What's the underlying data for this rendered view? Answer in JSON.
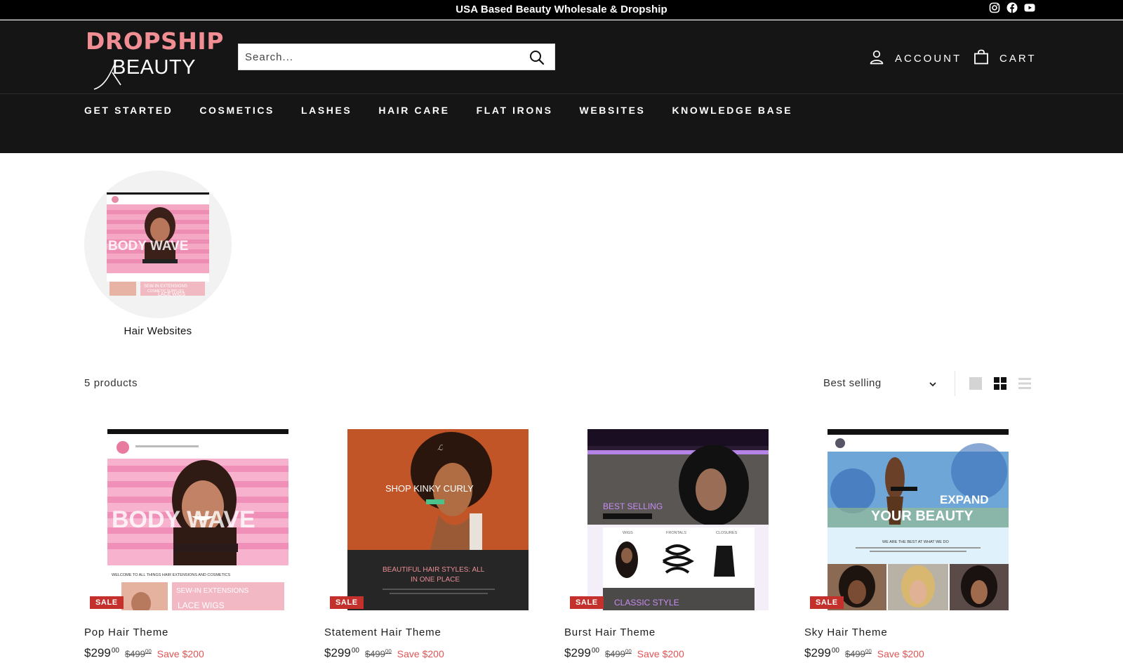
{
  "announcement": {
    "text": "USA Based Beauty Wholesale & Dropship"
  },
  "social_icons": [
    "instagram-icon",
    "facebook-icon",
    "youtube-icon"
  ],
  "logo": {
    "top": "DROPSHIP",
    "bottom": "BEAUTY"
  },
  "search": {
    "placeholder": "Search..."
  },
  "header": {
    "account_label": "ACCOUNT",
    "cart_label": "CART"
  },
  "nav": {
    "items": [
      {
        "label": "GET STARTED"
      },
      {
        "label": "COSMETICS"
      },
      {
        "label": "LASHES"
      },
      {
        "label": "HAIR CARE"
      },
      {
        "label": "FLAT IRONS"
      },
      {
        "label": "WEBSITES"
      },
      {
        "label": "KNOWLEDGE BASE"
      }
    ]
  },
  "collection": {
    "label": "Hair Websites",
    "thumb_text": "BODY WAVE",
    "thumb_sub": [
      "SEW-IN EXTENSIONS",
      "COSMETIC SUPPLIES",
      "LACE WIGS"
    ]
  },
  "toolbar": {
    "count": "5 products",
    "sort_value": "Best selling"
  },
  "products": [
    {
      "title": "Pop Hair Theme",
      "price_main": "$299",
      "price_cents": "00",
      "compare_main": "$499",
      "compare_cents": "00",
      "save": "Save $200",
      "badge": "SALE",
      "thumb_headline": "BODY WAVE",
      "thumb_sub": [
        "WELCOME TO ALL THINGS HAIR EXTENSIONS AND COSMETICS",
        "SEW-IN EXTENSIONS",
        "LACE WIGS"
      ]
    },
    {
      "title": "Statement Hair Theme",
      "price_main": "$299",
      "price_cents": "00",
      "compare_main": "$499",
      "compare_cents": "00",
      "save": "Save $200",
      "badge": "SALE",
      "thumb_headline": "SHOP KINKY CURLY",
      "thumb_sub": [
        "BEAUTIFUL HAIR STYLES: ALL",
        "IN ONE PLACE"
      ]
    },
    {
      "title": "Burst Hair Theme",
      "price_main": "$299",
      "price_cents": "00",
      "compare_main": "$499",
      "compare_cents": "00",
      "save": "Save $200",
      "badge": "SALE",
      "thumb_headline": "BEST SELLING",
      "thumb_sub": [
        "WIGS",
        "FRONTALS",
        "CLOSURES",
        "CLASSIC STYLE"
      ]
    },
    {
      "title": "Sky Hair Theme",
      "price_main": "$299",
      "price_cents": "00",
      "compare_main": "$499",
      "compare_cents": "00",
      "save": "Save $200",
      "badge": "SALE",
      "thumb_headline": "EXPAND",
      "thumb_headline2": "YOUR BEAUTY",
      "thumb_sub": [
        "WE ARE THE BEST AT WHAT WE DO"
      ]
    }
  ],
  "colors": {
    "brand_pink": "#f08e93",
    "header_bg": "#151515",
    "sale_red": "#c4302b",
    "save_red": "#e05555"
  }
}
